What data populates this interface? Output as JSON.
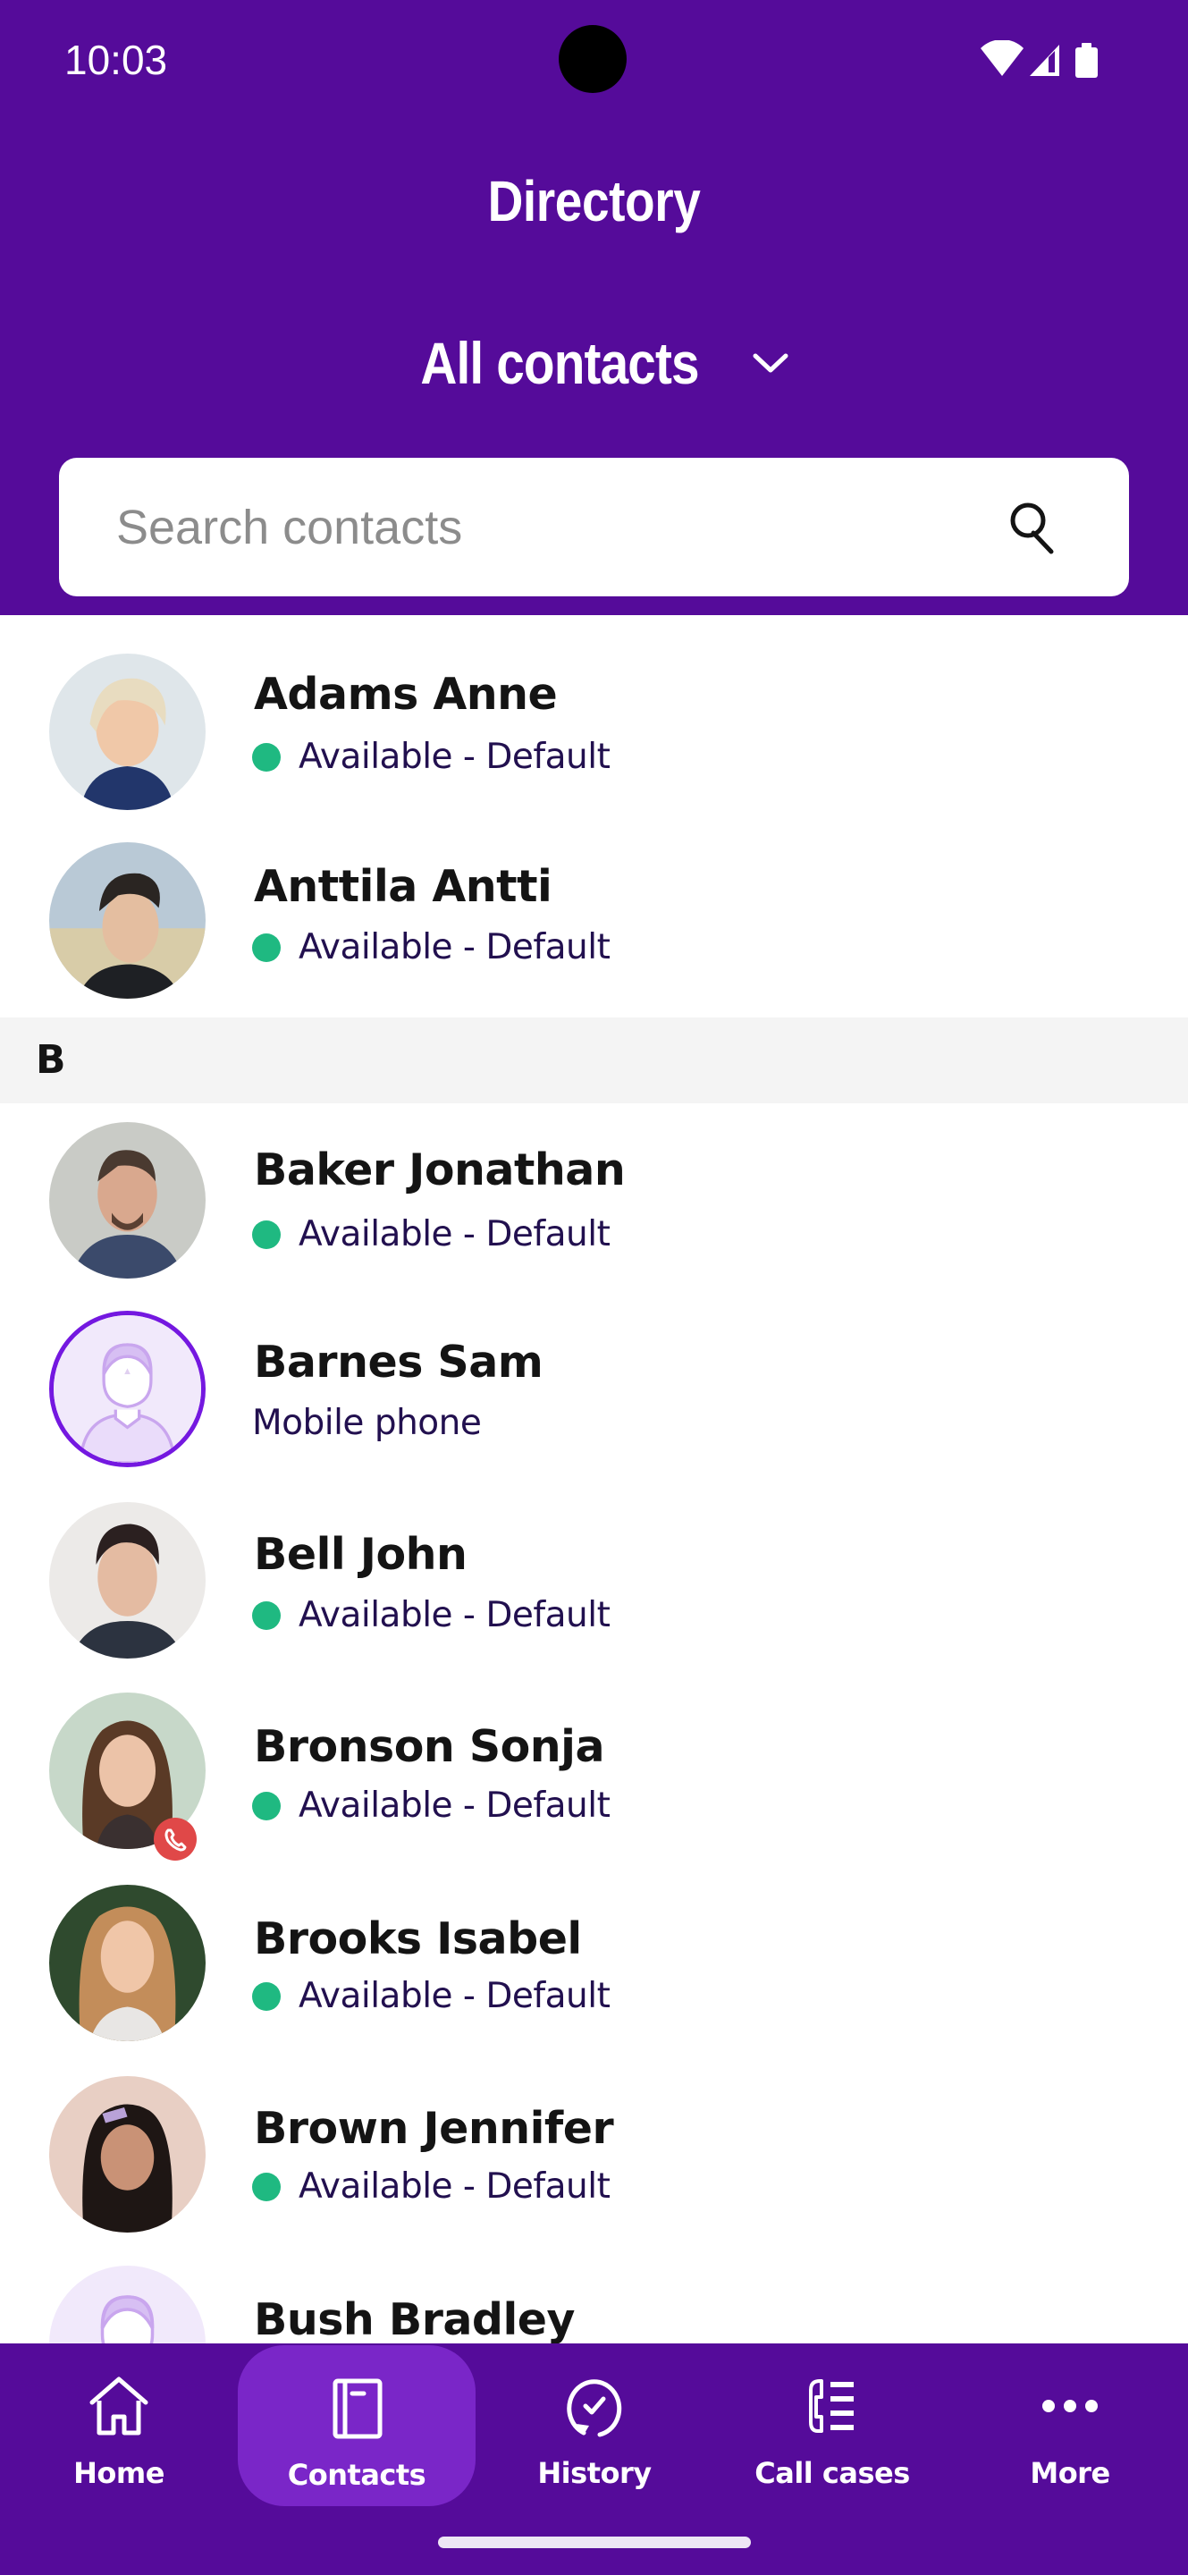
{
  "status_bar": {
    "time": "10:03",
    "icons": [
      "wifi-icon",
      "signal-icon",
      "battery-icon"
    ]
  },
  "header": {
    "title": "Directory",
    "filter_label": "All contacts",
    "filter_icon": "chevron-down-icon"
  },
  "search": {
    "placeholder": "Search contacts",
    "value": "",
    "icon": "search-icon"
  },
  "colors": {
    "brand_purple": "#550b9a",
    "active_tab": "#7a26c8",
    "available_green": "#1fb981",
    "call_badge_red": "#e04848",
    "section_bg": "#f4f4f4"
  },
  "contacts": [
    {
      "name": "Adams Anne",
      "status": "Available - Default",
      "presence": "available",
      "avatar": "photo"
    },
    {
      "name": "Anttila Antti",
      "status": "Available - Default",
      "presence": "available",
      "avatar": "photo"
    }
  ],
  "section_b": {
    "label": "B",
    "contacts": [
      {
        "name": "Baker Jonathan",
        "status": "Available - Default",
        "presence": "available",
        "avatar": "photo"
      },
      {
        "name": "Barnes Sam",
        "status": "Mobile phone",
        "presence": "none",
        "avatar": "placeholder"
      },
      {
        "name": "Bell John",
        "status": "Available - Default",
        "presence": "available",
        "avatar": "photo"
      },
      {
        "name": "Bronson Sonja",
        "status": "Available - Default",
        "presence": "available",
        "avatar": "photo",
        "badge": "on-call"
      },
      {
        "name": "Brooks Isabel",
        "status": "Available - Default",
        "presence": "available",
        "avatar": "photo"
      },
      {
        "name": "Brown Jennifer",
        "status": "Available - Default",
        "presence": "available",
        "avatar": "photo"
      },
      {
        "name": "Bush Bradley",
        "status": "",
        "presence": "none",
        "avatar": "placeholder"
      }
    ]
  },
  "nav": {
    "items": [
      {
        "label": "Home",
        "icon": "home-icon",
        "active": false
      },
      {
        "label": "Contacts",
        "icon": "contacts-book-icon",
        "active": true
      },
      {
        "label": "History",
        "icon": "history-icon",
        "active": false
      },
      {
        "label": "Call cases",
        "icon": "call-cases-icon",
        "active": false
      },
      {
        "label": "More",
        "icon": "more-icon",
        "active": false
      }
    ]
  }
}
